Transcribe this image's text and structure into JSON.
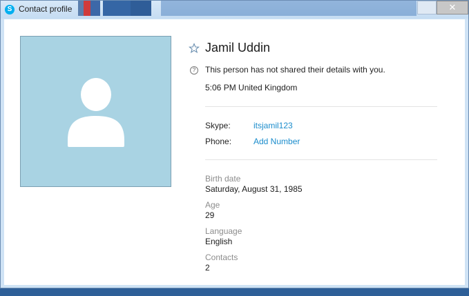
{
  "window": {
    "title": "Contact profile",
    "app_icon": "skype-icon",
    "close_glyph": "✕"
  },
  "profile": {
    "name": "Jamil Uddin",
    "favorite_icon": "star-outline-icon",
    "notice": "This person has not shared their details with you.",
    "notice_icon": "help-icon",
    "local_time": "5:06 PM United Kingdom",
    "avatar_icon": "person-placeholder-icon"
  },
  "contact_fields": [
    {
      "label": "Skype:",
      "value": "itsjamil123"
    },
    {
      "label": "Phone:",
      "value": "Add Number"
    }
  ],
  "details": [
    {
      "label": "Birth date",
      "value": "Saturday, August 31, 1985"
    },
    {
      "label": "Age",
      "value": "29"
    },
    {
      "label": "Language",
      "value": "English"
    },
    {
      "label": "Contacts",
      "value": "2"
    }
  ],
  "colors": {
    "accent_link": "#1a8ccc",
    "avatar_bg": "#a9d3e3"
  }
}
